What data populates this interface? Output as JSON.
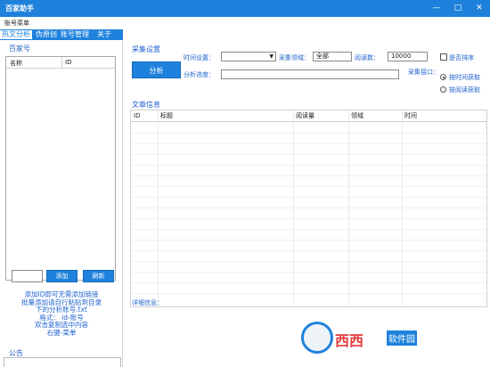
{
  "app": {
    "title": "百家助手"
  },
  "menu": {
    "label": "账号菜单"
  },
  "tabs": [
    {
      "label": "热文分析",
      "active": true
    },
    {
      "label": "伪原创",
      "active": false
    },
    {
      "label": "账号管理",
      "active": false
    },
    {
      "label": "关于",
      "active": false
    }
  ],
  "left": {
    "section_title": "百家号",
    "columns": [
      "名称",
      "ID"
    ],
    "add_label": "添加",
    "refresh_label": "刷新",
    "help_lines": [
      "添加ID即可无需添加链接",
      "批量添加请自行粘贴到目录",
      "下的分析账号.txt",
      "格式：  id-账号",
      "双击复制选中内容",
      "右键-菜单"
    ],
    "notice_title": "公告"
  },
  "right": {
    "collect_title": "采集设置",
    "analyze_label": "分析",
    "time_label": "时间设置：",
    "time_value": "",
    "field_label": "采集领域：",
    "field_value": "全部",
    "read_label": "阅读数：",
    "read_value": "10000",
    "sort_label": "是否排序",
    "progress_label": "分析进度：",
    "iface_label": "采集接口：",
    "radio_time": "按时间获取",
    "radio_read": "按阅读获取",
    "article_title": "文章信息",
    "columns": [
      "ID",
      "标题",
      "阅读量",
      "领域",
      "时间"
    ],
    "detail_label": "详细信息："
  },
  "watermark": {
    "logo_text": "西西",
    "logo_sub": "软件园"
  },
  "colors": {
    "accent": "#1e82dc",
    "label_blue": "#1e62d0"
  }
}
